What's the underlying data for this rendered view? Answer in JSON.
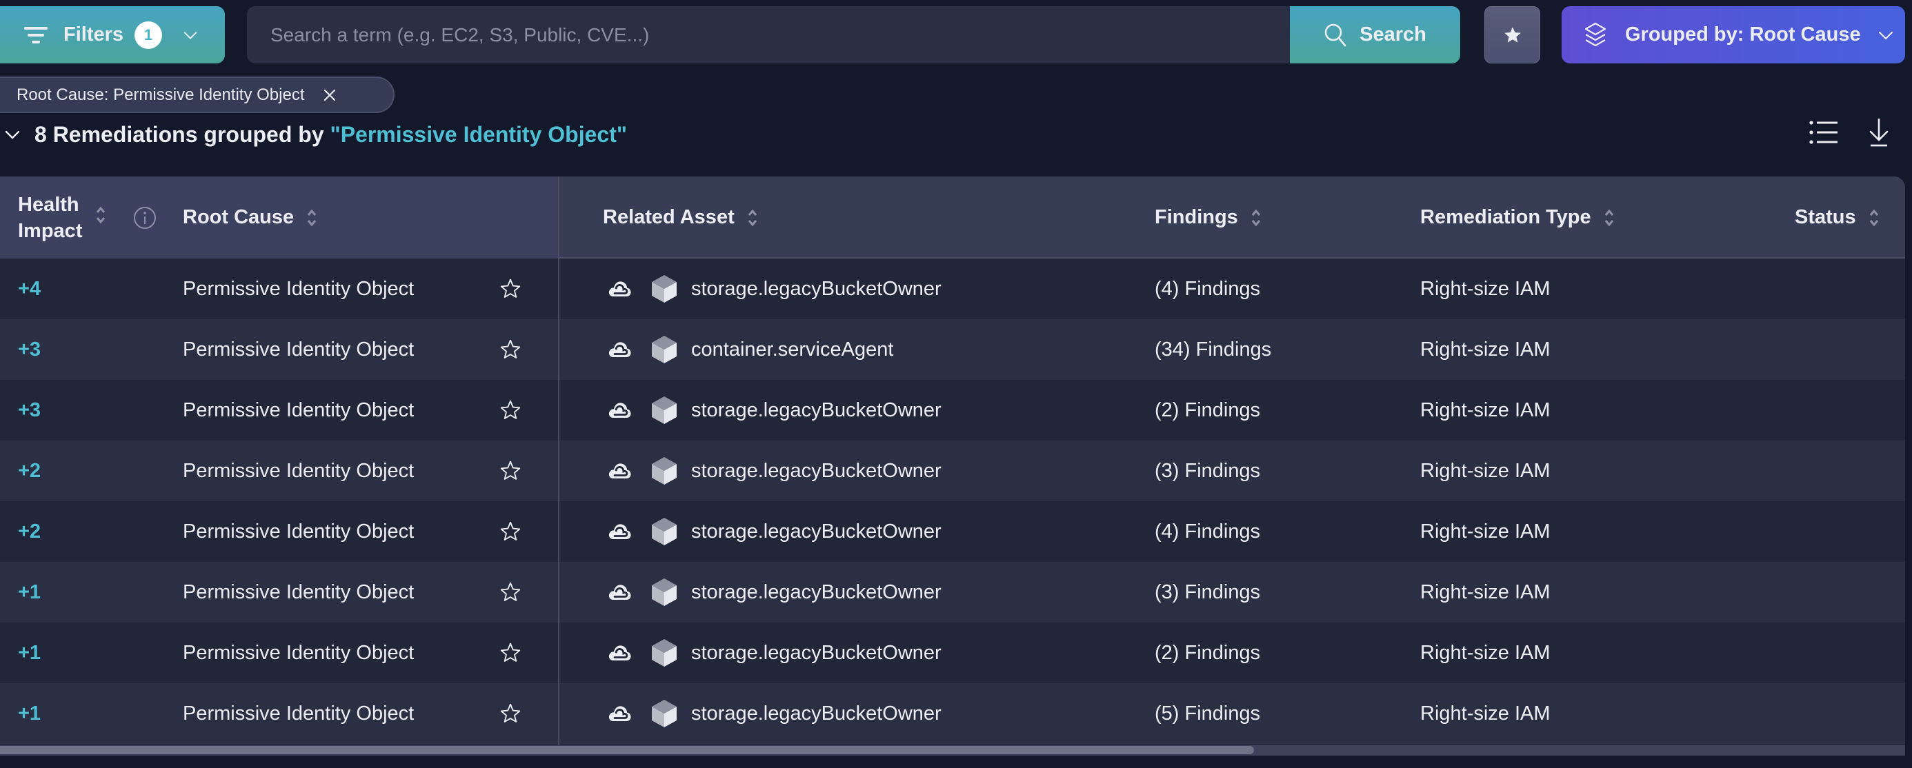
{
  "toolbar": {
    "filters_label": "Filters",
    "filters_count": "1",
    "search_placeholder": "Search a term (e.g. EC2, S3, Public, CVE...)",
    "search_value": "",
    "search_button_label": "Search",
    "group_button_label": "Grouped by: Root Cause"
  },
  "active_filters": [
    {
      "label": "Root Cause: Permissive Identity Object"
    }
  ],
  "group": {
    "count_text": "8 Remediations grouped by ",
    "value_text": "\"Permissive Identity Object\""
  },
  "colors": {
    "accent_teal": "#4fc0d4",
    "group_button": "#5d4fd3",
    "background": "#13182a"
  },
  "table": {
    "columns": {
      "health_impact": "Health Impact",
      "root_cause": "Root Cause",
      "related_asset": "Related Asset",
      "findings": "Findings",
      "remediation_type": "Remediation Type",
      "status": "Status"
    },
    "rows": [
      {
        "health_impact": "+4",
        "root_cause": "Permissive Identity Object",
        "asset_cloud_icon": "gcp-cloud-icon",
        "asset_type_icon": "cube-icon",
        "related_asset": "storage.legacyBucketOwner",
        "findings": "(4) Findings",
        "remediation_type": "Right-size IAM",
        "status": ""
      },
      {
        "health_impact": "+3",
        "root_cause": "Permissive Identity Object",
        "asset_cloud_icon": "gcp-cloud-icon",
        "asset_type_icon": "cube-icon",
        "related_asset": "container.serviceAgent",
        "findings": "(34) Findings",
        "remediation_type": "Right-size IAM",
        "status": ""
      },
      {
        "health_impact": "+3",
        "root_cause": "Permissive Identity Object",
        "asset_cloud_icon": "gcp-cloud-icon",
        "asset_type_icon": "cube-icon",
        "related_asset": "storage.legacyBucketOwner",
        "findings": "(2) Findings",
        "remediation_type": "Right-size IAM",
        "status": ""
      },
      {
        "health_impact": "+2",
        "root_cause": "Permissive Identity Object",
        "asset_cloud_icon": "gcp-cloud-icon",
        "asset_type_icon": "cube-icon",
        "related_asset": "storage.legacyBucketOwner",
        "findings": "(3) Findings",
        "remediation_type": "Right-size IAM",
        "status": ""
      },
      {
        "health_impact": "+2",
        "root_cause": "Permissive Identity Object",
        "asset_cloud_icon": "gcp-cloud-icon",
        "asset_type_icon": "cube-icon",
        "related_asset": "storage.legacyBucketOwner",
        "findings": "(4) Findings",
        "remediation_type": "Right-size IAM",
        "status": ""
      },
      {
        "health_impact": "+1",
        "root_cause": "Permissive Identity Object",
        "asset_cloud_icon": "gcp-cloud-icon",
        "asset_type_icon": "cube-icon",
        "related_asset": "storage.legacyBucketOwner",
        "findings": "(3) Findings",
        "remediation_type": "Right-size IAM",
        "status": ""
      },
      {
        "health_impact": "+1",
        "root_cause": "Permissive Identity Object",
        "asset_cloud_icon": "gcp-cloud-icon",
        "asset_type_icon": "cube-icon",
        "related_asset": "storage.legacyBucketOwner",
        "findings": "(2) Findings",
        "remediation_type": "Right-size IAM",
        "status": ""
      },
      {
        "health_impact": "+1",
        "root_cause": "Permissive Identity Object",
        "asset_cloud_icon": "gcp-cloud-icon",
        "asset_type_icon": "cube-icon",
        "related_asset": "storage.legacyBucketOwner",
        "findings": "(5) Findings",
        "remediation_type": "Right-size IAM",
        "status": ""
      }
    ]
  }
}
